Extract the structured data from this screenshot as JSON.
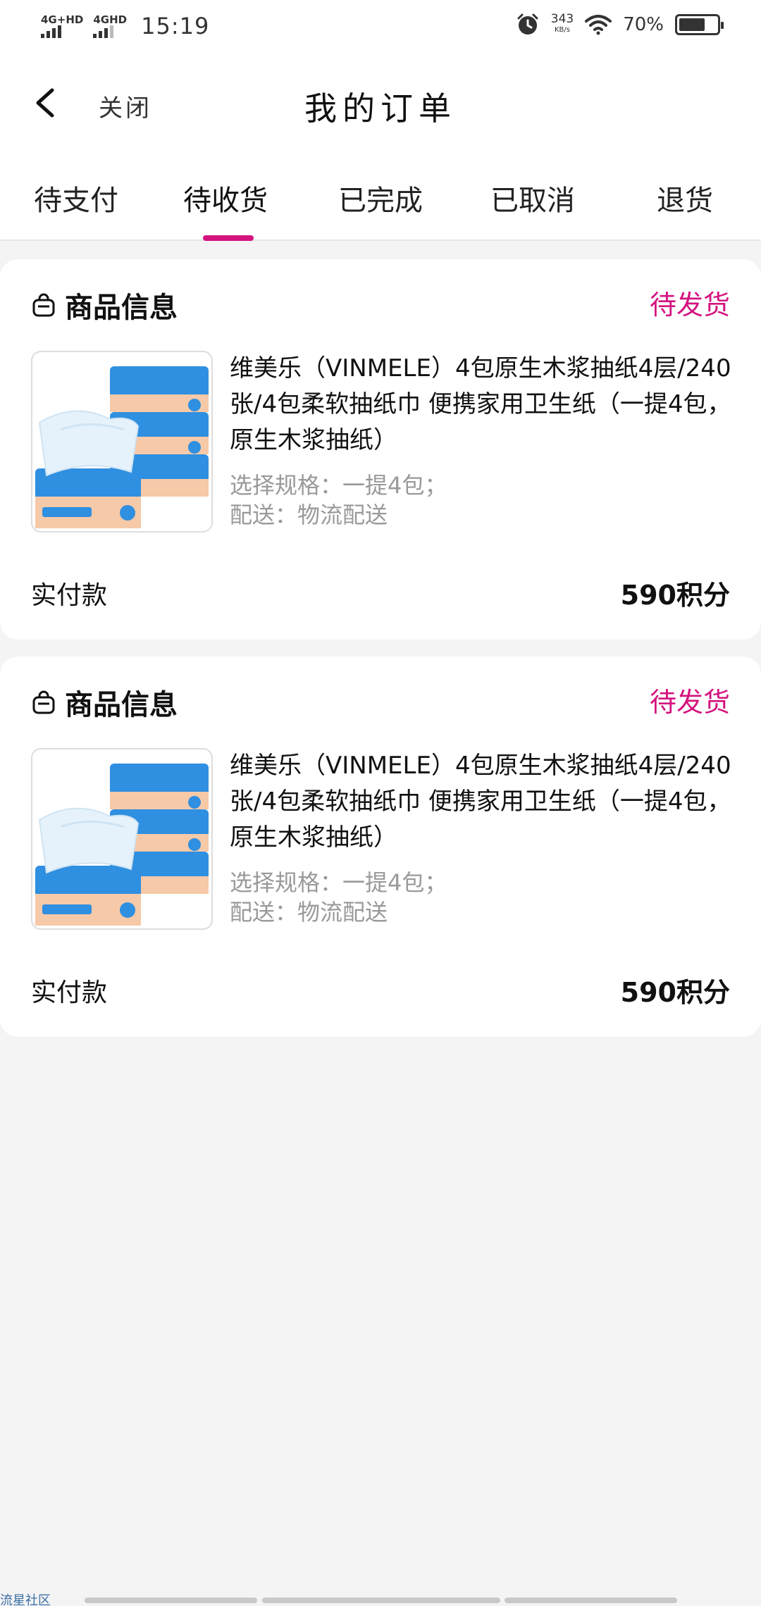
{
  "status_bar": {
    "signal1": "4G+HD",
    "signal2": "4GHD",
    "time": "15:19",
    "net_speed_value": "343",
    "net_speed_unit": "KB/s",
    "battery_percent": "70%",
    "battery_level": 0.7,
    "icons": [
      "alarm-icon",
      "wifi-icon",
      "battery-icon"
    ]
  },
  "nav": {
    "back_icon": "chevron-left-icon",
    "close_label": "关闭",
    "title": "我的订单"
  },
  "tabs": [
    {
      "label": "待支付",
      "active": false
    },
    {
      "label": "待收货",
      "active": true
    },
    {
      "label": "已完成",
      "active": false
    },
    {
      "label": "已取消",
      "active": false
    },
    {
      "label": "退货",
      "active": false
    }
  ],
  "colors": {
    "accent": "#d4137f",
    "muted_text": "#999999",
    "background": "#f4f4f4",
    "tissue_blue": "#2f8fe0",
    "tissue_peach": "#f6c9a8"
  },
  "orders": [
    {
      "header_icon": "shopping-bag-icon",
      "header_title": "商品信息",
      "status": "待发货",
      "product_name": "维美乐（VINMELE）4包原生木浆抽纸4层/240张/4包柔软抽纸巾 便携家用卫生纸（一提4包，原生木浆抽纸）",
      "spec": "选择规格：一提4包；",
      "delivery": "配送：物流配送",
      "paid_label": "实付款",
      "paid_value": "590积分"
    },
    {
      "header_icon": "shopping-bag-icon",
      "header_title": "商品信息",
      "status": "待发货",
      "product_name": "维美乐（VINMELE）4包原生木浆抽纸4层/240张/4包柔软抽纸巾 便携家用卫生纸（一提4包，原生木浆抽纸）",
      "spec": "选择规格：一提4包；",
      "delivery": "配送：物流配送",
      "paid_label": "实付款",
      "paid_value": "590积分"
    }
  ],
  "watermark": "流星社区"
}
